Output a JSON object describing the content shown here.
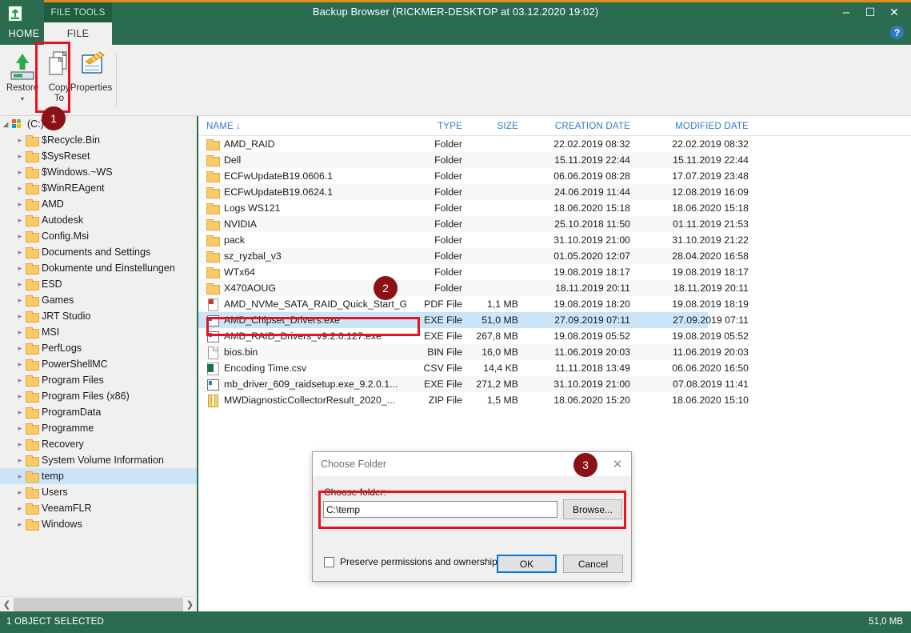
{
  "window": {
    "title": "Backup Browser (RICKMER-DESKTOP at 03.12.2020 19:02)",
    "minimize": "–",
    "maximize": "☐",
    "close": "✕",
    "help": "?",
    "app_icon": "backup-restore-icon"
  },
  "ribbon": {
    "context_tab_group": "FILE TOOLS",
    "tabs": [
      {
        "label": "HOME",
        "active": false
      },
      {
        "label": "FILE",
        "active": true
      }
    ],
    "items": [
      {
        "label_line1": "Restore",
        "label_line2": "",
        "icon": "restore-arrow-icon",
        "has_dropdown": true
      },
      {
        "label_line1": "Copy",
        "label_line2": "To",
        "icon": "copy-pages-icon",
        "has_dropdown": false
      },
      {
        "label_line1": "Properties",
        "label_line2": "",
        "icon": "properties-icon",
        "has_dropdown": false
      }
    ]
  },
  "tree": {
    "root": {
      "label": "(C:)",
      "icon": "drive-windows-icon",
      "expanded": true
    },
    "items": [
      {
        "label": "$Recycle.Bin",
        "selected": false
      },
      {
        "label": "$SysReset",
        "selected": false
      },
      {
        "label": "$Windows.~WS",
        "selected": false
      },
      {
        "label": "$WinREAgent",
        "selected": false
      },
      {
        "label": "AMD",
        "selected": false
      },
      {
        "label": "Autodesk",
        "selected": false
      },
      {
        "label": "Config.Msi",
        "selected": false
      },
      {
        "label": "Documents and Settings",
        "selected": false
      },
      {
        "label": "Dokumente und Einstellungen",
        "selected": false
      },
      {
        "label": "ESD",
        "selected": false
      },
      {
        "label": "Games",
        "selected": false
      },
      {
        "label": "JRT Studio",
        "selected": false
      },
      {
        "label": "MSI",
        "selected": false
      },
      {
        "label": "PerfLogs",
        "selected": false
      },
      {
        "label": "PowerShellMC",
        "selected": false
      },
      {
        "label": "Program Files",
        "selected": false
      },
      {
        "label": "Program Files (x86)",
        "selected": false
      },
      {
        "label": "ProgramData",
        "selected": false
      },
      {
        "label": "Programme",
        "selected": false
      },
      {
        "label": "Recovery",
        "selected": false
      },
      {
        "label": "System Volume Information",
        "selected": false
      },
      {
        "label": "temp",
        "selected": true
      },
      {
        "label": "Users",
        "selected": false
      },
      {
        "label": "VeeamFLR",
        "selected": false
      },
      {
        "label": "Windows",
        "selected": false
      }
    ],
    "scroll_left_arrow": "❮",
    "scroll_right_arrow": "❯"
  },
  "filelist": {
    "columns": [
      {
        "key": "name",
        "label": "NAME",
        "sorted": true,
        "sort_glyph": "↓"
      },
      {
        "key": "type",
        "label": "TYPE"
      },
      {
        "key": "size",
        "label": "SIZE"
      },
      {
        "key": "cdate",
        "label": "CREATION DATE"
      },
      {
        "key": "mdate",
        "label": "MODIFIED DATE"
      }
    ],
    "rows": [
      {
        "name": "AMD_RAID",
        "icon": "folder",
        "type": "Folder",
        "size": "",
        "cdate": "22.02.2019 08:32",
        "mdate": "22.02.2019 08:32",
        "selected": false
      },
      {
        "name": "Dell",
        "icon": "folder",
        "type": "Folder",
        "size": "",
        "cdate": "15.11.2019 22:44",
        "mdate": "15.11.2019 22:44",
        "selected": false
      },
      {
        "name": "ECFwUpdateB19.0606.1",
        "icon": "folder",
        "type": "Folder",
        "size": "",
        "cdate": "06.06.2019 08:28",
        "mdate": "17.07.2019 23:48",
        "selected": false
      },
      {
        "name": "ECFwUpdateB19.0624.1",
        "icon": "folder",
        "type": "Folder",
        "size": "",
        "cdate": "24.06.2019 11:44",
        "mdate": "12.08.2019 16:09",
        "selected": false
      },
      {
        "name": "Logs WS121",
        "icon": "folder",
        "type": "Folder",
        "size": "",
        "cdate": "18.06.2020 15:18",
        "mdate": "18.06.2020 15:18",
        "selected": false
      },
      {
        "name": "NVIDIA",
        "icon": "folder",
        "type": "Folder",
        "size": "",
        "cdate": "25.10.2018 11:50",
        "mdate": "01.11.2019 21:53",
        "selected": false
      },
      {
        "name": "pack",
        "icon": "folder",
        "type": "Folder",
        "size": "",
        "cdate": "31.10.2019 21:00",
        "mdate": "31.10.2019 21:22",
        "selected": false
      },
      {
        "name": "sz_ryzbal_v3",
        "icon": "folder",
        "type": "Folder",
        "size": "",
        "cdate": "01.05.2020 12:07",
        "mdate": "28.04.2020 16:58",
        "selected": false
      },
      {
        "name": "WTx64",
        "icon": "folder",
        "type": "Folder",
        "size": "",
        "cdate": "19.08.2019 18:17",
        "mdate": "19.08.2019 18:17",
        "selected": false
      },
      {
        "name": "X470AOUG",
        "icon": "folder",
        "type": "Folder",
        "size": "",
        "cdate": "18.11.2019 20:11",
        "mdate": "18.11.2019 20:11",
        "selected": false
      },
      {
        "name": "AMD_NVMe_SATA_RAID_Quick_Start_G...",
        "icon": "pdf",
        "type": "PDF File",
        "size": "1,1 MB",
        "cdate": "19.08.2019 18:20",
        "mdate": "19.08.2019 18:19",
        "selected": false
      },
      {
        "name": "AMD_Chipset_Drivers.exe",
        "icon": "exe",
        "type": "EXE File",
        "size": "51,0 MB",
        "cdate": "27.09.2019 07:11",
        "mdate": "27.09.2019 07:11",
        "selected": true
      },
      {
        "name": "AMD_RAID_Drivers_v9.2.0.127.exe",
        "icon": "exe",
        "type": "EXE File",
        "size": "267,8 MB",
        "cdate": "19.08.2019 05:52",
        "mdate": "19.08.2019 05:52",
        "selected": false
      },
      {
        "name": "bios.bin",
        "icon": "doc",
        "type": "BIN File",
        "size": "16,0 MB",
        "cdate": "11.06.2019 20:03",
        "mdate": "11.06.2019 20:03",
        "selected": false
      },
      {
        "name": "Encoding Time.csv",
        "icon": "csv",
        "type": "CSV File",
        "size": "14,4 KB",
        "cdate": "11.11.2018 13:49",
        "mdate": "06.06.2020 16:50",
        "selected": false
      },
      {
        "name": "mb_driver_609_raidsetup.exe_9.2.0.1...",
        "icon": "exe",
        "type": "EXE File",
        "size": "271,2 MB",
        "cdate": "31.10.2019 21:00",
        "mdate": "07.08.2019 11:41",
        "selected": false
      },
      {
        "name": "MWDiagnosticCollectorResult_2020_...",
        "icon": "zip",
        "type": "ZIP File",
        "size": "1,5 MB",
        "cdate": "18.06.2020 15:20",
        "mdate": "18.06.2020 15:10",
        "selected": false
      }
    ]
  },
  "dialog": {
    "title": "Choose Folder",
    "close": "✕",
    "field_label": "Choose folder:",
    "field_value": "C:\\temp",
    "field_placeholder": "",
    "browse_label": "Browse...",
    "checkbox_label": "Preserve permissions and ownership",
    "checkbox_checked": false,
    "ok_label": "OK",
    "cancel_label": "Cancel"
  },
  "statusbar": {
    "left": "1 OBJECT SELECTED",
    "right": "51,0 MB"
  },
  "annotations": [
    {
      "number": "1"
    },
    {
      "number": "2"
    },
    {
      "number": "3"
    }
  ],
  "colors": {
    "brand_green": "#2b6b4f",
    "accent_orange": "#e08c1a",
    "annotation_red": "#e81123",
    "badge_dark_red": "#8c1117",
    "selection_blue": "#cce4f7",
    "header_blue": "#2f7cc4"
  }
}
